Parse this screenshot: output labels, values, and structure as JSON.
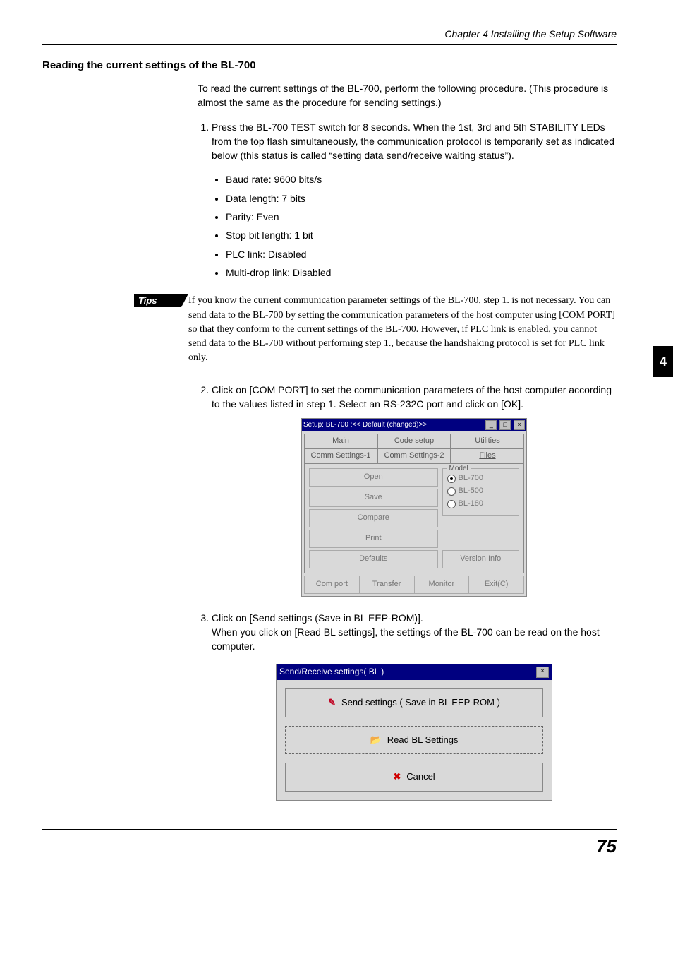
{
  "header": "Chapter 4     Installing the Setup Software",
  "section_title": "Reading the current settings of the BL-700",
  "intro": "To read the current settings of the BL-700, perform the following procedure. (This procedure is almost the same as the procedure for sending settings.)",
  "step1": "Press the BL-700 TEST switch for 8 seconds. When the 1st, 3rd and 5th STABILITY LEDs from the top flash simultaneously, the communication protocol is temporarily set as indicated below (this status is called “setting data send/receive waiting status”).",
  "bullets": [
    "Baud rate: 9600 bits/s",
    "Data length: 7 bits",
    "Parity: Even",
    "Stop bit length: 1 bit",
    "PLC link: Disabled",
    "Multi-drop link: Disabled"
  ],
  "tips_label": "Tips",
  "tips_body": "If you know the current communication parameter settings of the BL-700, step 1. is not necessary. You can send data to the BL-700 by setting the communication parameters of the host computer using [COM PORT] so that they conform to the current settings of the BL-700. However, if PLC link is enabled, you cannot send data to the BL-700 without performing step 1., because the handshaking protocol is set for PLC link only.",
  "step2": "Click on [COM PORT] to set the communication parameters of the host computer according to the values listed in step 1. Select an RS-232C port and click on [OK].",
  "step3a": "Click on [Send settings (Save in BL EEP-ROM)].",
  "step3b": "When you click on [Read BL settings], the settings of the BL-700 can be read on the host computer.",
  "side_tab": "4",
  "page_number": "75",
  "app": {
    "title": "Setup: BL-700 :<< Default (changed)>>",
    "tabs_row1": [
      "Main",
      "Code setup",
      "Utilities"
    ],
    "tabs_row2": [
      "Comm Settings-1",
      "Comm Settings-2",
      "Files"
    ],
    "buttons": [
      "Open",
      "Save",
      "Compare",
      "Print",
      "Defaults"
    ],
    "model_legend": "Model",
    "models": [
      "BL-700",
      "BL-500",
      "BL-180"
    ],
    "version_btn": "Version Info",
    "bottom": [
      "Com port",
      "Transfer",
      "Monitor",
      "Exit(C)"
    ]
  },
  "dialog": {
    "title": "Send/Receive settings( BL )",
    "btn1": "Send settings ( Save in BL EEP-ROM )",
    "btn2": "Read BL Settings",
    "btn3": "Cancel"
  }
}
